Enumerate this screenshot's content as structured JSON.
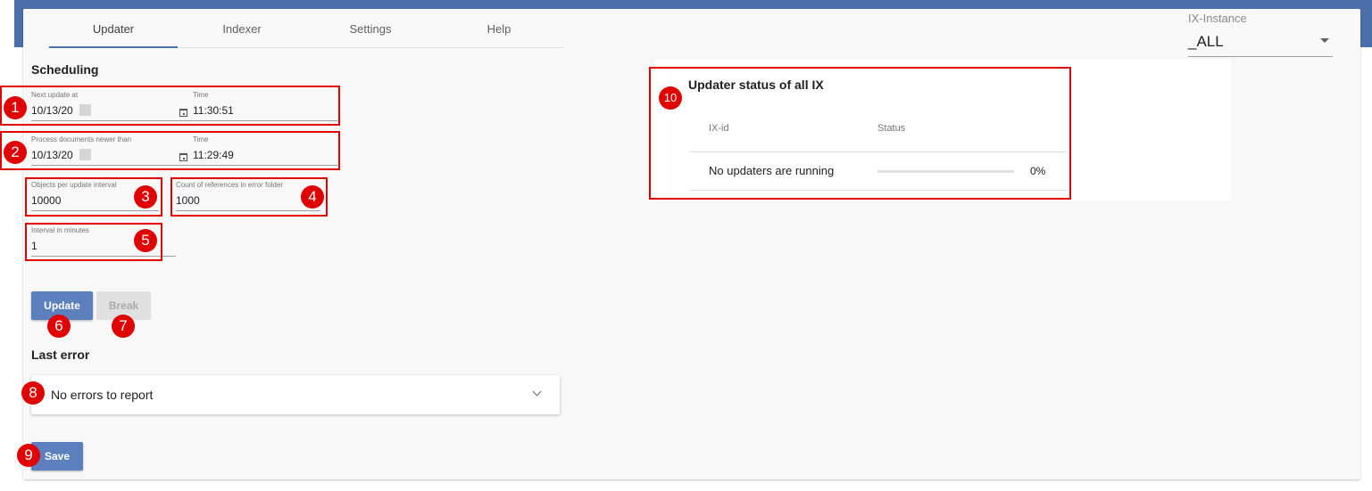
{
  "tabs": [
    {
      "label": "Updater",
      "active": true
    },
    {
      "label": "Indexer",
      "active": false
    },
    {
      "label": "Settings",
      "active": false
    },
    {
      "label": "Help",
      "active": false
    }
  ],
  "ix_instance": {
    "label": "IX-Instance",
    "value": "_ALL"
  },
  "scheduling": {
    "title": "Scheduling",
    "next_update": {
      "date_label": "Next update at",
      "date_value": "10/13/20",
      "time_label": "Time",
      "time_value": "11:30:51"
    },
    "process_newer": {
      "date_label": "Process documents newer than",
      "date_value": "10/13/20",
      "time_label": "Time",
      "time_value": "11:29:49"
    },
    "objects_per_interval": {
      "label": "Objects per update interval",
      "value": "10000"
    },
    "count_references": {
      "label": "Count of references in error folder",
      "value": "1000"
    },
    "interval_minutes": {
      "label": "Interval in minutes",
      "value": "1"
    }
  },
  "buttons": {
    "update": "Update",
    "break": "Break",
    "save": "Save"
  },
  "last_error": {
    "title": "Last error",
    "message": "No errors to report"
  },
  "status_panel": {
    "title": "Updater status of all IX",
    "columns": [
      "IX-id",
      "Status"
    ],
    "rows": [
      {
        "id": "No updaters are running",
        "progress": 0,
        "percent": "0%"
      }
    ]
  },
  "badges": [
    "1",
    "2",
    "3",
    "4",
    "5",
    "6",
    "7",
    "8",
    "9",
    "10"
  ],
  "colors": {
    "header": "#4b6fa8",
    "primary_button": "#5b80bd",
    "highlight": "#e00000"
  }
}
